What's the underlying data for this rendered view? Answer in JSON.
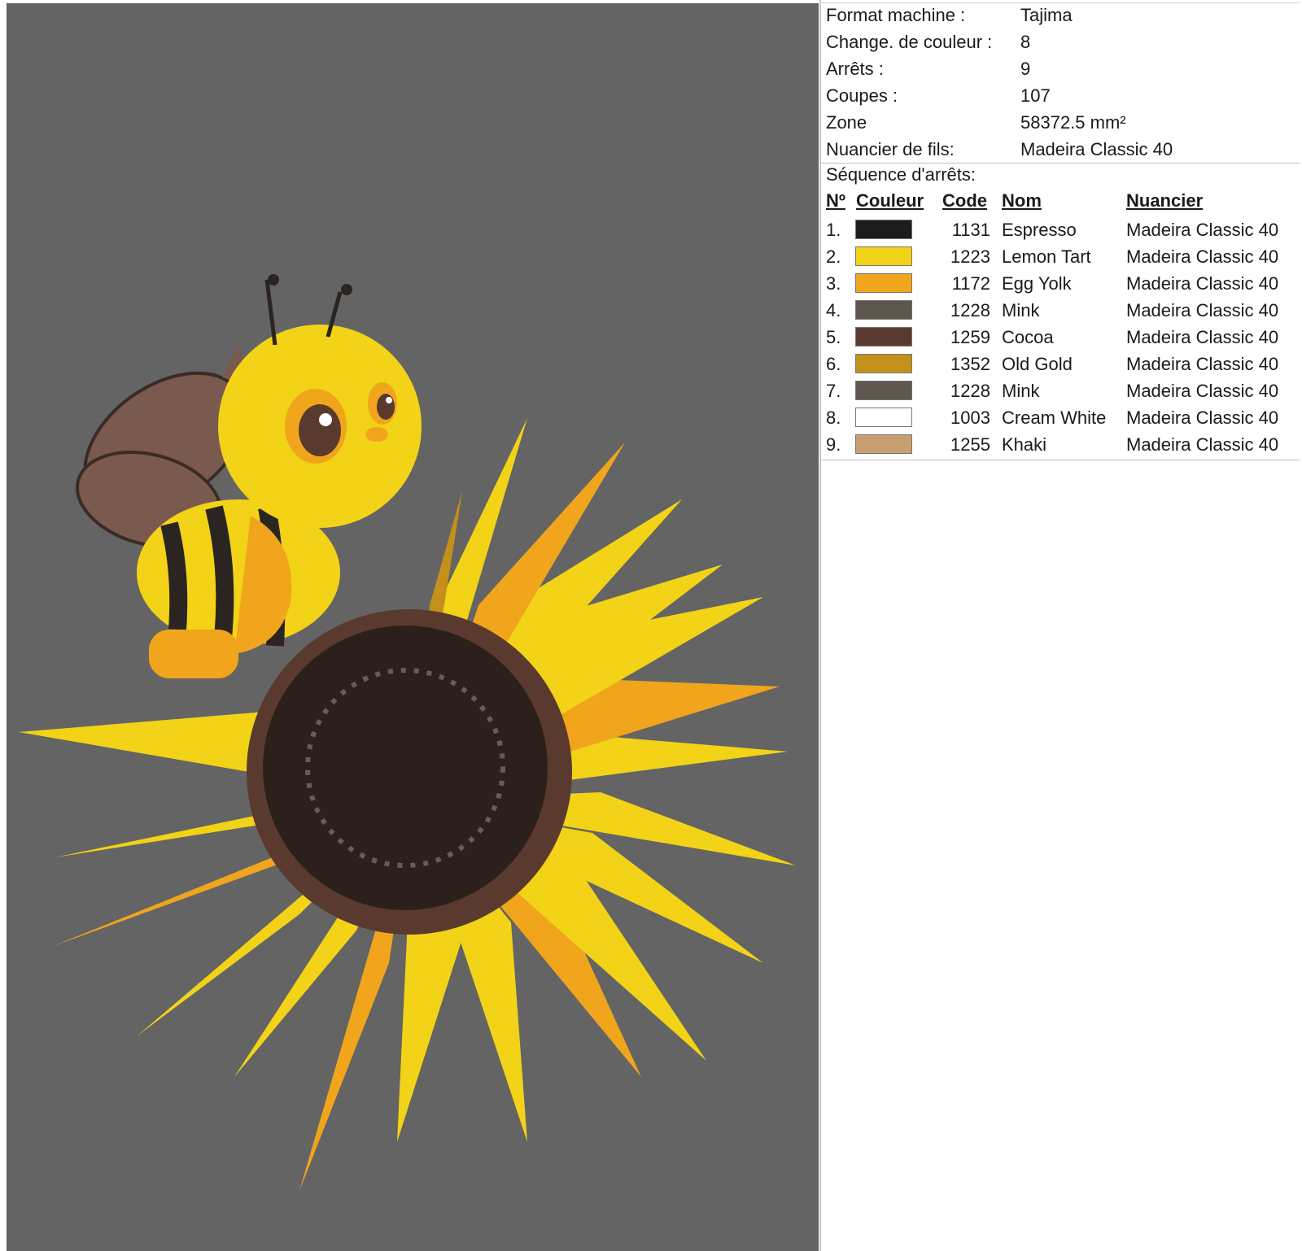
{
  "info": [
    {
      "label": "Format machine :",
      "value": "Tajima"
    },
    {
      "label": "Change. de couleur :",
      "value": "8"
    },
    {
      "label": "Arrêts :",
      "value": "9"
    },
    {
      "label": "Coupes :",
      "value": "107"
    },
    {
      "label": "Zone",
      "value": "58372.5 mm²"
    },
    {
      "label": "Nuancier de fils:",
      "value": "Madeira Classic 40"
    }
  ],
  "sequence": {
    "title": "Séquence d'arrêts:",
    "headers": {
      "no": "Nº",
      "couleur": "Couleur",
      "code": "Code",
      "nom": "Nom",
      "nuancier": "Nuancier"
    },
    "rows": [
      {
        "no": "1.",
        "color": "#1c1c1c",
        "code": "1131",
        "nom": "Espresso",
        "nuancier": "Madeira Classic 40"
      },
      {
        "no": "2.",
        "color": "#f2d317",
        "code": "1223",
        "nom": "Lemon Tart",
        "nuancier": "Madeira Classic 40"
      },
      {
        "no": "3.",
        "color": "#f0a51c",
        "code": "1172",
        "nom": "Egg Yolk",
        "nuancier": "Madeira Classic 40"
      },
      {
        "no": "4.",
        "color": "#5e554c",
        "code": "1228",
        "nom": "Mink",
        "nuancier": "Madeira Classic 40"
      },
      {
        "no": "5.",
        "color": "#5a3a2e",
        "code": "1259",
        "nom": "Cocoa",
        "nuancier": "Madeira Classic 40"
      },
      {
        "no": "6.",
        "color": "#c4901a",
        "code": "1352",
        "nom": "Old Gold",
        "nuancier": "Madeira Classic 40"
      },
      {
        "no": "7.",
        "color": "#5f574d",
        "code": "1228",
        "nom": "Mink",
        "nuancier": "Madeira Classic 40"
      },
      {
        "no": "8.",
        "color": "#ffffff",
        "code": "1003",
        "nom": "Cream White",
        "nuancier": "Madeira Classic 40"
      },
      {
        "no": "9.",
        "color": "#c8a070",
        "code": "1255",
        "nom": "Khaki",
        "nuancier": "Madeira Classic 40"
      }
    ]
  }
}
